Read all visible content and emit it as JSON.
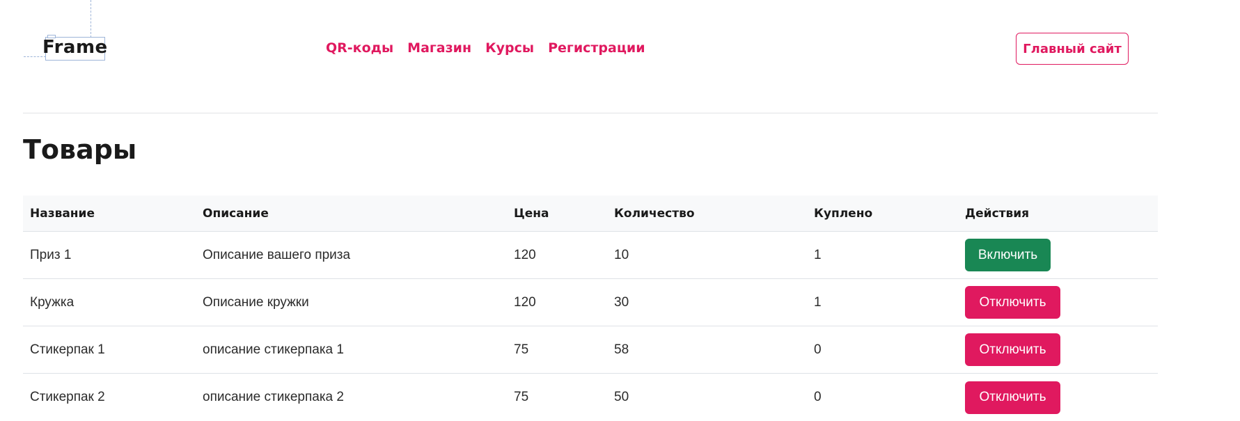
{
  "header": {
    "logo_text": "Frame",
    "nav": [
      "QR-коды",
      "Магазин",
      "Курсы",
      "Регистрации"
    ],
    "main_site_label": "Главный сайт",
    "accent_color": "#e0195f"
  },
  "page": {
    "title": "Товары"
  },
  "table": {
    "columns": [
      "Название",
      "Описание",
      "Цена",
      "Количество",
      "Куплено",
      "Действия"
    ],
    "rows": [
      {
        "name": "Приз 1",
        "description": "Описание вашего приза",
        "price": "120",
        "quantity": "10",
        "bought": "1",
        "action": "Включить",
        "action_type": "enable"
      },
      {
        "name": "Кружка",
        "description": "Описание кружки",
        "price": "120",
        "quantity": "30",
        "bought": "1",
        "action": "Отключить",
        "action_type": "disable"
      },
      {
        "name": "Стикерпак 1",
        "description": "описание стикерпака 1",
        "price": "75",
        "quantity": "58",
        "bought": "0",
        "action": "Отключить",
        "action_type": "disable"
      },
      {
        "name": "Стикерпак 2",
        "description": "описание стикерпака 2",
        "price": "75",
        "quantity": "50",
        "bought": "0",
        "action": "Отключить",
        "action_type": "disable"
      }
    ],
    "enable_color": "#198754",
    "disable_color": "#e0195f"
  }
}
